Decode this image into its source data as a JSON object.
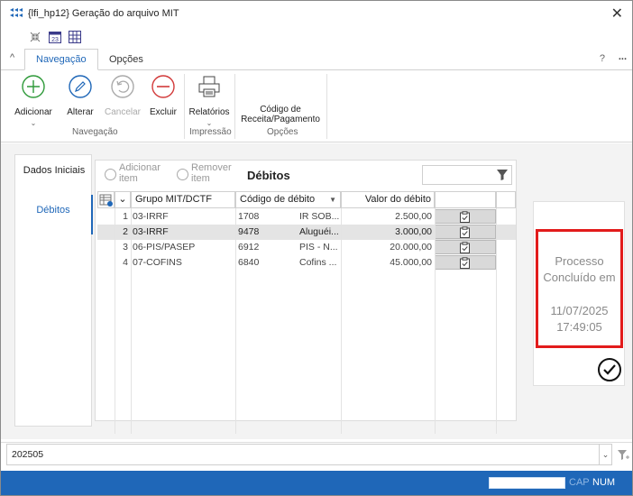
{
  "window": {
    "title": "{lfi_hp12} Geração do arquivo MIT"
  },
  "tabs": [
    {
      "label": "Navegação"
    },
    {
      "label": "Opções"
    }
  ],
  "help": "?",
  "more": "...",
  "ribbon": {
    "buttons": [
      {
        "label": "Adicionar"
      },
      {
        "label": "Alterar"
      },
      {
        "label": "Cancelar"
      },
      {
        "label": "Excluir"
      },
      {
        "label": "Relatórios"
      },
      {
        "label_line1": "Código de",
        "label_line2": "Receita/Pagamento"
      }
    ],
    "groups": [
      "Navegação",
      "Impressão",
      "Opções"
    ]
  },
  "leftnav": [
    {
      "label": "Dados Iniciais"
    },
    {
      "label": "Débitos"
    }
  ],
  "panel": {
    "add_line1": "Adicionar",
    "add_line2": "item",
    "remove_line1": "Remover",
    "remove_line2": "item",
    "title": "Débitos"
  },
  "grid": {
    "columns": [
      "Grupo MIT/DCTF",
      "Código de débito",
      "Valor do débito"
    ],
    "rows": [
      {
        "n": "1",
        "grupo": "03-IRRF",
        "codigo": "1708",
        "desc": "IR SOB...",
        "valor": "2.500,00"
      },
      {
        "n": "2",
        "grupo": "03-IRRF",
        "codigo": "9478",
        "desc": "Aluguéi...",
        "valor": "3.000,00"
      },
      {
        "n": "3",
        "grupo": "06-PIS/PASEP",
        "codigo": "6912",
        "desc": "PIS - N...",
        "valor": "20.000,00"
      },
      {
        "n": "4",
        "grupo": "07-COFINS",
        "codigo": "6840",
        "desc": "Cofins ...",
        "valor": "45.000,00"
      }
    ]
  },
  "status_card": {
    "line1": "Processo",
    "line2": "Concluído em",
    "date": "11/07/2025",
    "time": "17:49:05"
  },
  "bottom": {
    "combo_value": "202505"
  },
  "statusbar": {
    "cap": "CAP",
    "num": "NUM"
  },
  "colors": {
    "accent": "#1f67b8",
    "highlight": "#e21b1b"
  }
}
